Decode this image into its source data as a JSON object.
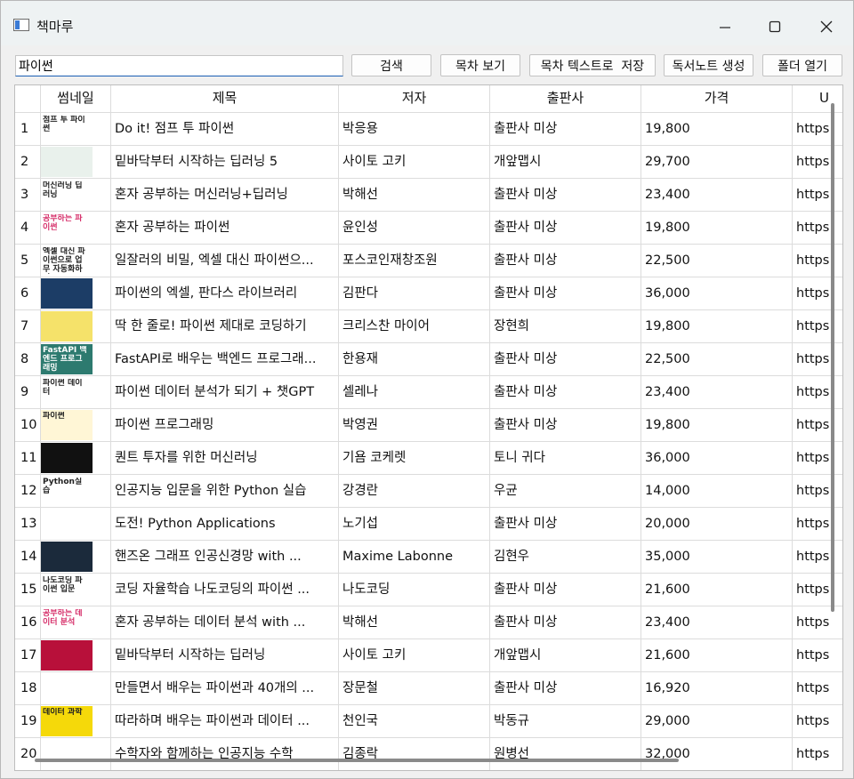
{
  "window": {
    "title": "책마루"
  },
  "toolbar": {
    "search_value": "파이썬",
    "buttons": [
      "검색",
      "목차 보기",
      "목차 텍스트로  저장",
      "독서노트 생성",
      "폴더 열기"
    ]
  },
  "table": {
    "headers": [
      "썸네일",
      "제목",
      "저자",
      "출판사",
      "가격",
      "U"
    ],
    "rows": [
      {
        "no": "1",
        "title": "Do it! 점프 투 파이썬",
        "author": "박응용",
        "publisher": "출판사 미상",
        "price": "19,800",
        "url": "https"
      },
      {
        "no": "2",
        "title": "밑바닥부터 시작하는 딥러닝 5",
        "author": "사이토 고키",
        "publisher": "개앞맵시",
        "price": "29,700",
        "url": "https"
      },
      {
        "no": "3",
        "title": "혼자 공부하는 머신러닝+딥러닝",
        "author": "박해선",
        "publisher": "출판사 미상",
        "price": "23,400",
        "url": "https"
      },
      {
        "no": "4",
        "title": "혼자 공부하는 파이썬",
        "author": "윤인성",
        "publisher": "출판사 미상",
        "price": "19,800",
        "url": "https"
      },
      {
        "no": "5",
        "title": "일잘러의 비밀, 엑셀 대신 파이썬으...",
        "author": "포스코인재창조원",
        "publisher": "출판사 미상",
        "price": "22,500",
        "url": "https"
      },
      {
        "no": "6",
        "title": "파이썬의 엑셀, 판다스 라이브러리",
        "author": "김판다",
        "publisher": "출판사 미상",
        "price": "36,000",
        "url": "https"
      },
      {
        "no": "7",
        "title": "딱 한 줄로! 파이썬 제대로 코딩하기",
        "author": "크리스찬 마이어",
        "publisher": "장현희",
        "price": "19,800",
        "url": "https"
      },
      {
        "no": "8",
        "title": "FastAPI로 배우는 백엔드 프로그래...",
        "author": "한용재",
        "publisher": "출판사 미상",
        "price": "22,500",
        "url": "https"
      },
      {
        "no": "9",
        "title": "파이썬 데이터 분석가 되기 + 챗GPT",
        "author": "셀레나",
        "publisher": "출판사 미상",
        "price": "23,400",
        "url": "https"
      },
      {
        "no": "10",
        "title": "파이썬 프로그래밍",
        "author": "박영권",
        "publisher": "출판사 미상",
        "price": "19,800",
        "url": "https"
      },
      {
        "no": "11",
        "title": "퀀트 투자를 위한 머신러닝",
        "author": "기욤 코케렛",
        "publisher": "토니 귀다",
        "price": "36,000",
        "url": "https"
      },
      {
        "no": "12",
        "title": "인공지능 입문을 위한 Python 실습",
        "author": "강경란",
        "publisher": "우균",
        "price": "14,000",
        "url": "https"
      },
      {
        "no": "13",
        "title": "도전! Python Applications",
        "author": "노기섭",
        "publisher": "출판사 미상",
        "price": "20,000",
        "url": "https"
      },
      {
        "no": "14",
        "title": "핸즈온 그래프 인공신경망 with ...",
        "author": "Maxime Labonne",
        "publisher": "김현우",
        "price": "35,000",
        "url": "https"
      },
      {
        "no": "15",
        "title": "코딩 자율학습 나도코딩의 파이썬 ...",
        "author": "나도코딩",
        "publisher": "출판사 미상",
        "price": "21,600",
        "url": "https"
      },
      {
        "no": "16",
        "title": "혼자 공부하는 데이터 분석 with ...",
        "author": "박해선",
        "publisher": "출판사 미상",
        "price": "23,400",
        "url": "https"
      },
      {
        "no": "17",
        "title": "밑바닥부터 시작하는 딥러닝",
        "author": "사이토 고키",
        "publisher": "개앞맵시",
        "price": "21,600",
        "url": "https"
      },
      {
        "no": "18",
        "title": "만들면서 배우는 파이썬과 40개의 ...",
        "author": "장문철",
        "publisher": "출판사 미상",
        "price": "16,920",
        "url": "https"
      },
      {
        "no": "19",
        "title": "따라하며 배우는 파이썬과 데이터 ...",
        "author": "천인국",
        "publisher": "박동규",
        "price": "29,000",
        "url": "https"
      },
      {
        "no": "20",
        "title": "수학자와 함께하는 인공지능 수학",
        "author": "김종락",
        "publisher": "원병선",
        "price": "32,000",
        "url": "https"
      }
    ]
  },
  "thumb_texts": {
    "t1": "점프 투 파이썬",
    "t3": "머신러닝 딥러닝",
    "t4": "공부하는 파이썬",
    "t5": "엑셀 대신 파이썬으로 업무 자동화하기",
    "t8": "FastAPI 백엔드 프로그래밍",
    "t9": "파이썬 데이터",
    "t10": "파이썬",
    "t12": "Python실습",
    "t15": "나도코딩 파이썬 입문",
    "t16": "공부하는 데이터 분석",
    "t19": "데이터 과학"
  },
  "thumb_colors": [
    "#ffffff",
    "#e9f1ec",
    "#ffffff",
    "#ffffff",
    "#ffffff",
    "#1c3d66",
    "#f5e26a",
    "#2d7a6f",
    "#ffffff",
    "#fff6d6",
    "#111111",
    "#ffffff",
    "#ffffff",
    "#1b2a3b",
    "#ffffff",
    "#ffffff",
    "#b8103a",
    "#ffffff",
    "#f5d90a",
    "#ffffff"
  ]
}
